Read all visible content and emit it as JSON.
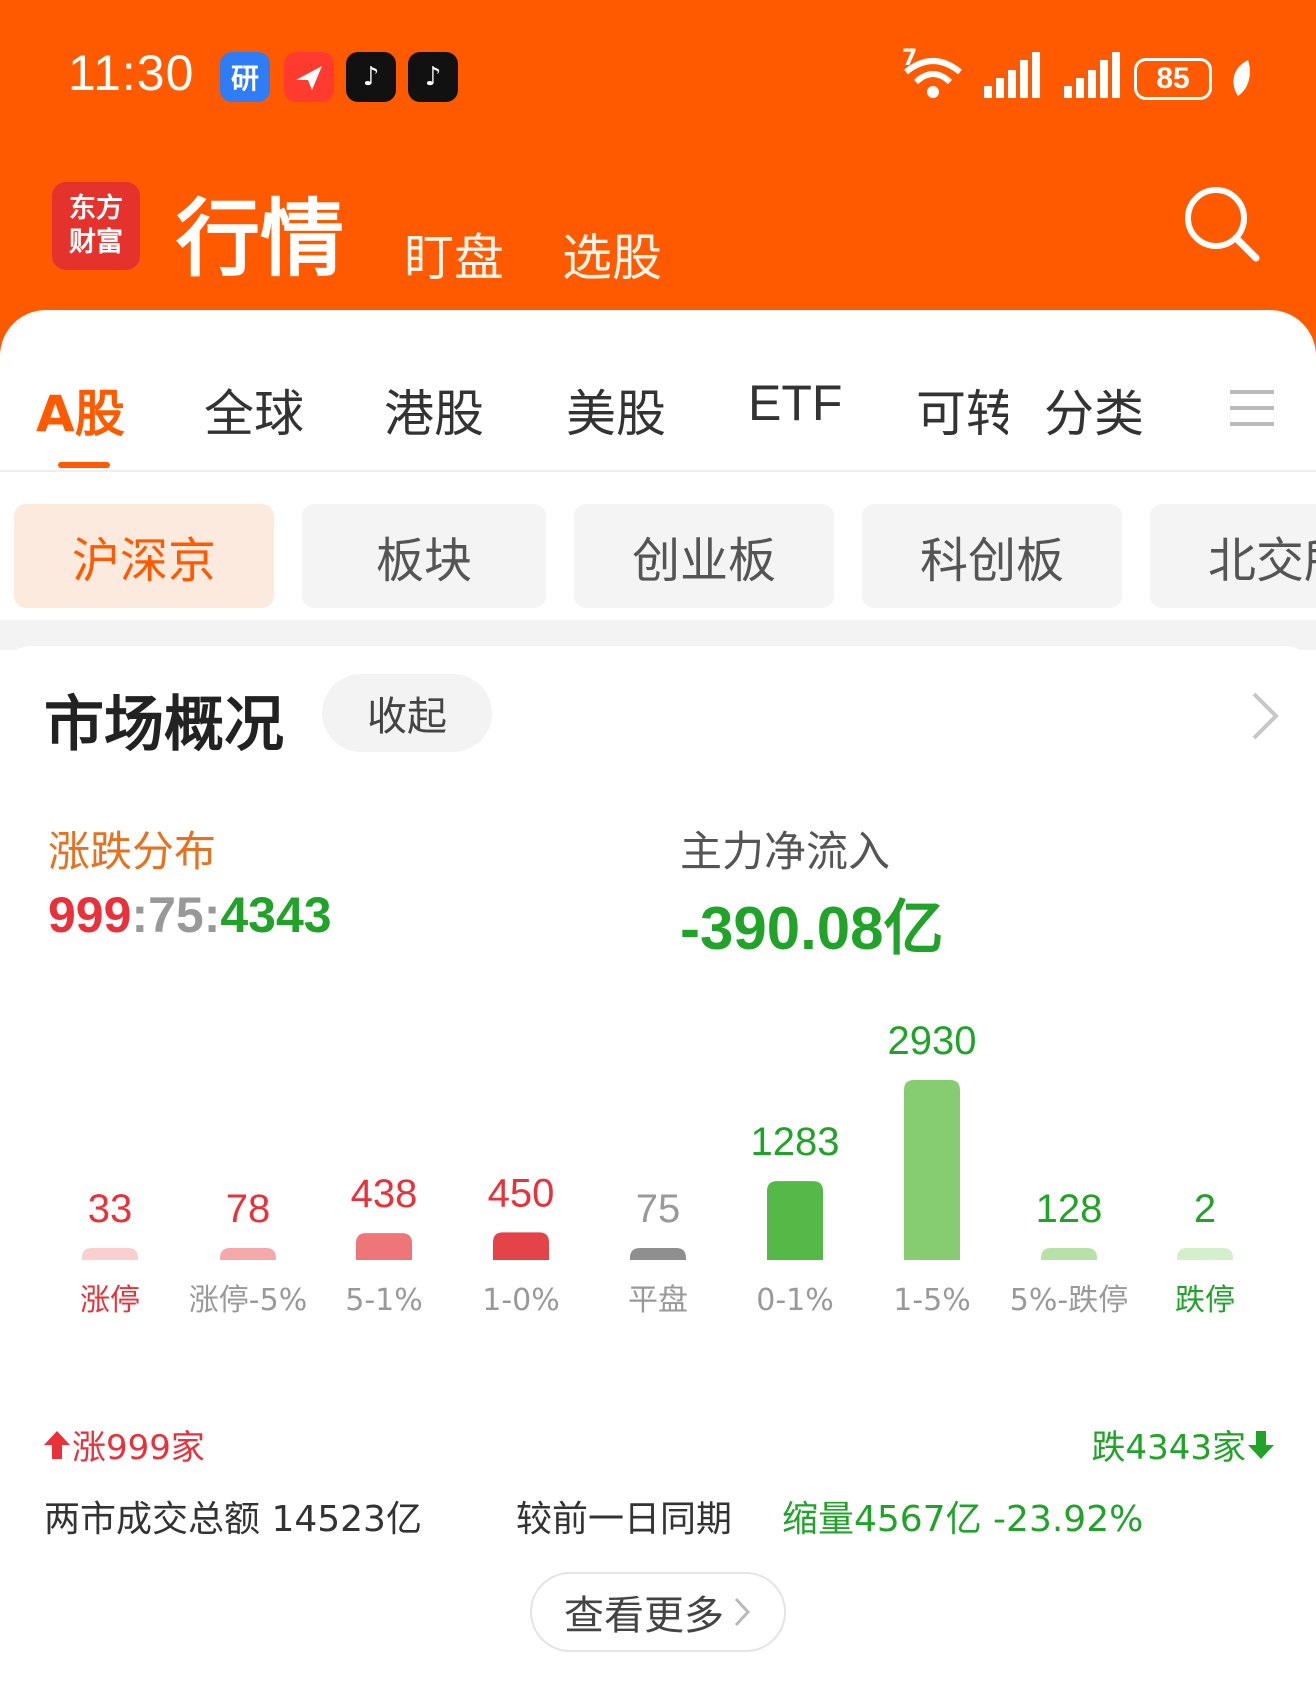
{
  "status_bar": {
    "time": "11:30",
    "app_icons": [
      {
        "name": "yan-app-icon",
        "glyph": "研"
      },
      {
        "name": "feishu-app-icon",
        "glyph": ""
      },
      {
        "name": "tiktok-app-icon",
        "glyph": "♪"
      },
      {
        "name": "tiktok-app-icon-2",
        "glyph": "♪"
      }
    ],
    "wifi_badge": "7",
    "battery": "85"
  },
  "header": {
    "logo_line1": "东方",
    "logo_line2": "财富",
    "title": "行情",
    "tabs": [
      "盯盘",
      "选股"
    ]
  },
  "market_tabs": [
    "A股",
    "全球",
    "港股",
    "美股",
    "ETF",
    "可转",
    "分类"
  ],
  "active_market_tab": "A股",
  "sub_tabs": [
    "沪深京",
    "板块",
    "创业板",
    "科创板",
    "北交所"
  ],
  "active_sub_tab": "沪深京",
  "overview": {
    "title": "市场概况",
    "collapse_label": "收起",
    "distribution_label": "涨跌分布",
    "rise_count": "999",
    "flat_count": "75",
    "fall_count": "4343",
    "sep": ":",
    "inflow_label": "主力净流入",
    "inflow_value": "-390.08亿",
    "rise_summary": "涨999家",
    "fall_summary": "跌4343家",
    "total_label": "两市成交总额 14523亿",
    "compare_label": "较前一日同期",
    "shrink_label": "缩量4567亿  -23.92%",
    "more_label": "查看更多"
  },
  "colors": {
    "brand": "#ff5a00",
    "rise": "#e8313a",
    "fall": "#21a32a",
    "flat": "#999999"
  },
  "chart_data": {
    "type": "bar",
    "categories": [
      "涨停",
      "涨停-5%",
      "5-1%",
      "1-0%",
      "平盘",
      "0-1%",
      "1-5%",
      "5%-跌停",
      "跌停"
    ],
    "values": [
      33,
      78,
      438,
      450,
      75,
      1283,
      2930,
      128,
      2
    ],
    "bar_colors": [
      "#f9cfcf",
      "#f6a9ab",
      "#ee7678",
      "#e5434a",
      "#8f8f8f",
      "#55b947",
      "#86cd72",
      "#b6e2a8",
      "#d4efcb"
    ],
    "value_colors": [
      "#e8313a",
      "#e8313a",
      "#e8313a",
      "#e8313a",
      "#999999",
      "#21a32a",
      "#21a32a",
      "#21a32a",
      "#21a32a"
    ],
    "label_colors": [
      "#e8313a",
      "#999999",
      "#999999",
      "#999999",
      "#999999",
      "#999999",
      "#999999",
      "#999999",
      "#21a32a"
    ],
    "ylim": [
      0,
      2930
    ],
    "ratio_bar": {
      "rise": 999,
      "flat": 75,
      "fall": 4343
    }
  }
}
